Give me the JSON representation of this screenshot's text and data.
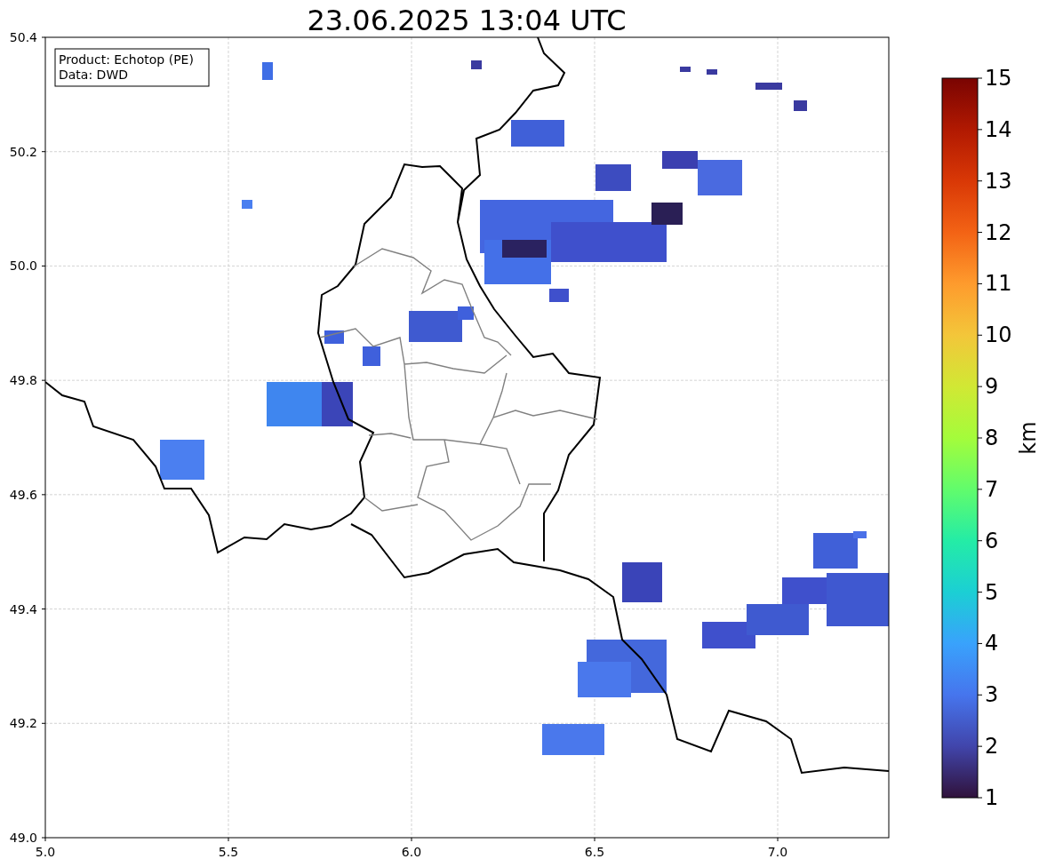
{
  "title": "23.06.2025 13:04 UTC",
  "legend": [
    "Product: Echotop (PE)",
    "Data: DWD"
  ],
  "x_ticks": [
    "5.0",
    "5.5",
    "6.0",
    "6.5",
    "7.0"
  ],
  "y_ticks": [
    "50.4",
    "50.2",
    "50.0",
    "49.8",
    "49.6",
    "49.4",
    "49.2",
    "49.0"
  ],
  "colorbar": {
    "label": "km",
    "ticks": [
      "15",
      "14",
      "13",
      "12",
      "11",
      "10",
      "9",
      "8",
      "7",
      "6",
      "5",
      "4",
      "3",
      "2",
      "1"
    ]
  }
}
